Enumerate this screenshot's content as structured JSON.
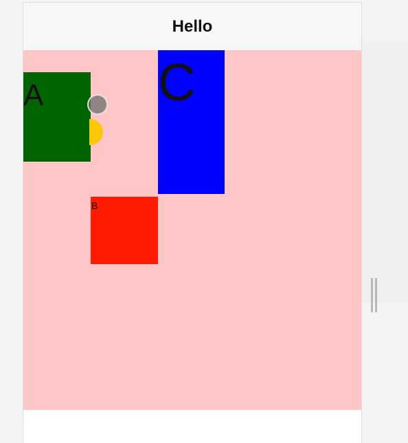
{
  "nav": {
    "title": "Hello"
  },
  "boxes": {
    "a": {
      "label": "A",
      "color": "#006400"
    },
    "b": {
      "label": "B",
      "color": "#ff1a00"
    },
    "c": {
      "label": "C",
      "color": "#0000ff"
    }
  },
  "colors": {
    "content_background": "#ffc6c7",
    "yellow_circle": "#ffc800",
    "touch_indicator": "#6e6e6e"
  },
  "icons": {
    "resize_handle": "vertical-double-bar-icon",
    "touch_indicator": "touch-point-icon"
  }
}
